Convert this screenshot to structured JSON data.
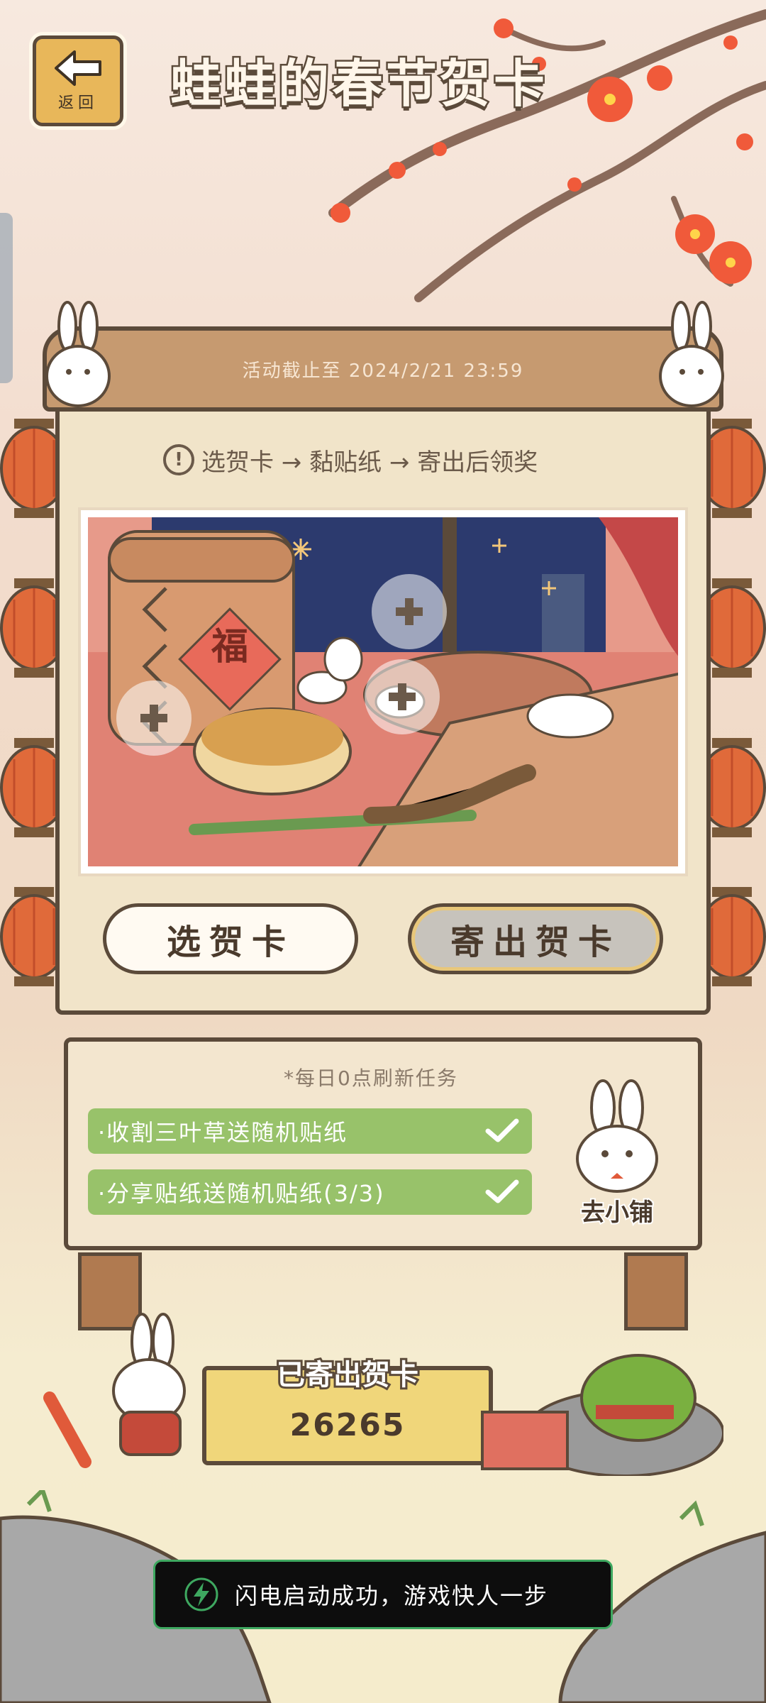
{
  "header": {
    "back_label": "返回",
    "title": "蛙蛙的春节贺卡"
  },
  "board": {
    "deadline": "活动截止至 2024/2/21 23:59",
    "instructions": "选贺卡 → 黏贴纸 → 寄出后领奖",
    "card_character": "福",
    "select_card_label": "选贺卡",
    "send_card_label": "寄出贺卡"
  },
  "tasks": {
    "refresh_note": "*每日0点刷新任务",
    "items": [
      {
        "label": "·收割三叶草送随机贴纸"
      },
      {
        "label": "·分享贴纸送随机贴纸(3/3)"
      }
    ],
    "shop_label": "去小铺"
  },
  "counter": {
    "title": "已寄出贺卡",
    "value": "26265"
  },
  "toast": {
    "text": "闪电启动成功，游戏快人一步"
  },
  "colors": {
    "wood": "#c69a70",
    "outline": "#5b4a3a",
    "task_green": "#98c26a",
    "toast_border": "#3ea860",
    "blossom": "#f05a3a"
  },
  "icons": {
    "back": "left-arrow-icon",
    "info": "exclamation-icon",
    "add": "plus-icon",
    "check": "check-icon",
    "lightning": "lightning-icon"
  }
}
